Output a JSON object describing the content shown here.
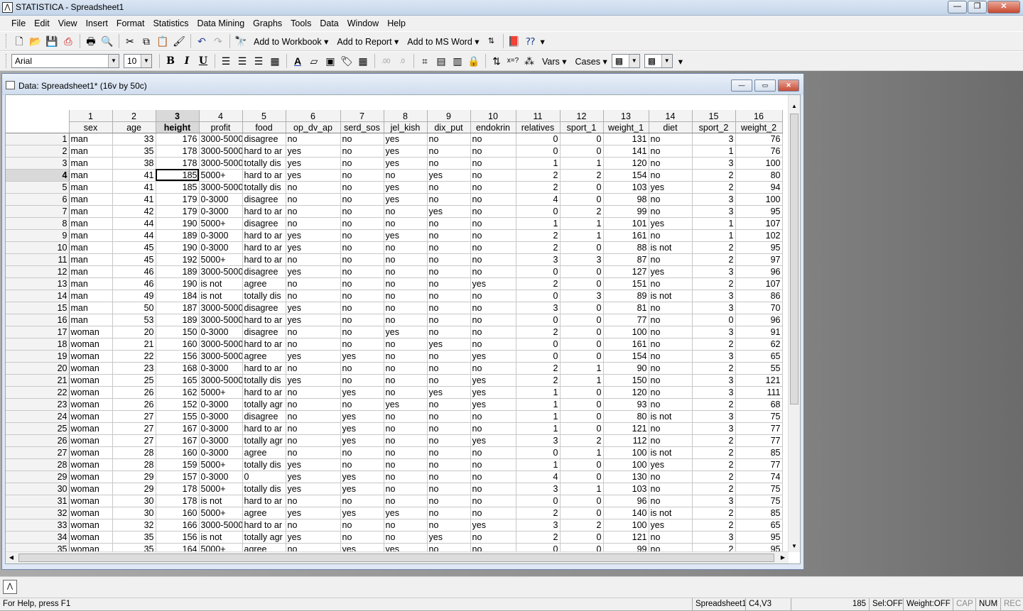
{
  "window": {
    "title": "STATISTICA - Spreadsheet1",
    "app_icon": "statistica-icon"
  },
  "menu": [
    "File",
    "Edit",
    "View",
    "Insert",
    "Format",
    "Statistics",
    "Data Mining",
    "Graphs",
    "Tools",
    "Data",
    "Window",
    "Help"
  ],
  "toolbar1": {
    "add_to_workbook": "Add to Workbook",
    "add_to_report": "Add to Report",
    "add_to_msword": "Add to MS Word"
  },
  "toolbar2": {
    "font": "Arial",
    "size": "10",
    "bold": "B",
    "italic": "I",
    "underline": "U",
    "vars": "Vars",
    "cases": "Cases"
  },
  "document": {
    "title": "Data: Spreadsheet1* (16v by 50c)",
    "selected_column": 3,
    "selected_row": 4,
    "columns": [
      {
        "num": "1",
        "name": "sex",
        "align": "t"
      },
      {
        "num": "2",
        "name": "age",
        "align": "n"
      },
      {
        "num": "3",
        "name": "height",
        "align": "n"
      },
      {
        "num": "4",
        "name": "profit",
        "align": "t"
      },
      {
        "num": "5",
        "name": "food",
        "align": "t"
      },
      {
        "num": "6",
        "name": "op_dv_ap",
        "align": "t"
      },
      {
        "num": "7",
        "name": "serd_sos",
        "align": "t"
      },
      {
        "num": "8",
        "name": "jel_kish",
        "align": "t"
      },
      {
        "num": "9",
        "name": "dix_put",
        "align": "t"
      },
      {
        "num": "10",
        "name": "endokrin",
        "align": "t"
      },
      {
        "num": "11",
        "name": "relatives",
        "align": "n"
      },
      {
        "num": "12",
        "name": "sport_1",
        "align": "n"
      },
      {
        "num": "13",
        "name": "weight_1",
        "align": "n"
      },
      {
        "num": "14",
        "name": "diet",
        "align": "t"
      },
      {
        "num": "15",
        "name": "sport_2",
        "align": "n"
      },
      {
        "num": "16",
        "name": "weight_2",
        "align": "n"
      }
    ],
    "rows": [
      [
        "1",
        "man",
        "33",
        "176",
        "3000-5000",
        "disagree",
        "no",
        "no",
        "yes",
        "no",
        "no",
        "0",
        "0",
        "131",
        "no",
        "3",
        "76"
      ],
      [
        "2",
        "man",
        "35",
        "178",
        "3000-5000",
        "hard to ar",
        "yes",
        "no",
        "yes",
        "no",
        "no",
        "0",
        "0",
        "141",
        "no",
        "1",
        "76"
      ],
      [
        "3",
        "man",
        "38",
        "178",
        "3000-5000",
        "totally dis",
        "yes",
        "no",
        "yes",
        "no",
        "no",
        "1",
        "1",
        "120",
        "no",
        "3",
        "100"
      ],
      [
        "4",
        "man",
        "41",
        "185",
        "5000+",
        "hard to ar",
        "yes",
        "no",
        "no",
        "yes",
        "no",
        "2",
        "2",
        "154",
        "no",
        "2",
        "80"
      ],
      [
        "5",
        "man",
        "41",
        "185",
        "3000-5000",
        "totally dis",
        "no",
        "no",
        "yes",
        "no",
        "no",
        "2",
        "0",
        "103",
        "yes",
        "2",
        "94"
      ],
      [
        "6",
        "man",
        "41",
        "179",
        "0-3000",
        "disagree",
        "no",
        "no",
        "yes",
        "no",
        "no",
        "4",
        "0",
        "98",
        "no",
        "3",
        "100"
      ],
      [
        "7",
        "man",
        "42",
        "179",
        "0-3000",
        "hard to ar",
        "no",
        "no",
        "no",
        "yes",
        "no",
        "0",
        "2",
        "99",
        "no",
        "3",
        "95"
      ],
      [
        "8",
        "man",
        "44",
        "190",
        "5000+",
        "disagree",
        "no",
        "no",
        "no",
        "no",
        "no",
        "1",
        "1",
        "101",
        "yes",
        "1",
        "107"
      ],
      [
        "9",
        "man",
        "44",
        "189",
        "0-3000",
        "hard to ar",
        "yes",
        "no",
        "yes",
        "no",
        "no",
        "2",
        "1",
        "161",
        "no",
        "1",
        "102"
      ],
      [
        "10",
        "man",
        "45",
        "190",
        "0-3000",
        "hard to ar",
        "yes",
        "no",
        "no",
        "no",
        "no",
        "2",
        "0",
        "88",
        "is not",
        "2",
        "95"
      ],
      [
        "11",
        "man",
        "45",
        "192",
        "5000+",
        "hard to ar",
        "no",
        "no",
        "no",
        "no",
        "no",
        "3",
        "3",
        "87",
        "no",
        "2",
        "97"
      ],
      [
        "12",
        "man",
        "46",
        "189",
        "3000-5000",
        "disagree",
        "yes",
        "no",
        "no",
        "no",
        "no",
        "0",
        "0",
        "127",
        "yes",
        "3",
        "96"
      ],
      [
        "13",
        "man",
        "46",
        "190",
        "is not",
        "agree",
        "no",
        "no",
        "no",
        "no",
        "yes",
        "2",
        "0",
        "151",
        "no",
        "2",
        "107"
      ],
      [
        "14",
        "man",
        "49",
        "184",
        "is not",
        "totally dis",
        "no",
        "no",
        "no",
        "no",
        "no",
        "0",
        "3",
        "89",
        "is not",
        "3",
        "86"
      ],
      [
        "15",
        "man",
        "50",
        "187",
        "3000-5000",
        "disagree",
        "yes",
        "no",
        "no",
        "no",
        "no",
        "3",
        "0",
        "81",
        "no",
        "3",
        "70"
      ],
      [
        "16",
        "man",
        "53",
        "189",
        "3000-5000",
        "hard to ar",
        "yes",
        "no",
        "no",
        "no",
        "no",
        "0",
        "0",
        "77",
        "no",
        "0",
        "96"
      ],
      [
        "17",
        "woman",
        "20",
        "150",
        "0-3000",
        "disagree",
        "no",
        "no",
        "yes",
        "no",
        "no",
        "2",
        "0",
        "100",
        "no",
        "3",
        "91"
      ],
      [
        "18",
        "woman",
        "21",
        "160",
        "3000-5000",
        "hard to ar",
        "no",
        "no",
        "no",
        "yes",
        "no",
        "0",
        "0",
        "161",
        "no",
        "2",
        "62"
      ],
      [
        "19",
        "woman",
        "22",
        "156",
        "3000-5000",
        "agree",
        "yes",
        "yes",
        "no",
        "no",
        "yes",
        "0",
        "0",
        "154",
        "no",
        "3",
        "65"
      ],
      [
        "20",
        "woman",
        "23",
        "168",
        "0-3000",
        "hard to ar",
        "no",
        "no",
        "no",
        "no",
        "no",
        "2",
        "1",
        "90",
        "no",
        "2",
        "55"
      ],
      [
        "21",
        "woman",
        "25",
        "165",
        "3000-5000",
        "totally dis",
        "yes",
        "no",
        "no",
        "no",
        "yes",
        "2",
        "1",
        "150",
        "no",
        "3",
        "121"
      ],
      [
        "22",
        "woman",
        "26",
        "162",
        "5000+",
        "hard to ar",
        "no",
        "yes",
        "no",
        "yes",
        "yes",
        "1",
        "0",
        "120",
        "no",
        "3",
        "111"
      ],
      [
        "23",
        "woman",
        "26",
        "152",
        "0-3000",
        "totally agr",
        "no",
        "no",
        "yes",
        "no",
        "yes",
        "1",
        "0",
        "93",
        "no",
        "2",
        "68"
      ],
      [
        "24",
        "woman",
        "27",
        "155",
        "0-3000",
        "disagree",
        "no",
        "yes",
        "no",
        "no",
        "no",
        "1",
        "0",
        "80",
        "is not",
        "3",
        "75"
      ],
      [
        "25",
        "woman",
        "27",
        "167",
        "0-3000",
        "hard to ar",
        "no",
        "yes",
        "no",
        "no",
        "no",
        "1",
        "0",
        "121",
        "no",
        "3",
        "77"
      ],
      [
        "26",
        "woman",
        "27",
        "167",
        "0-3000",
        "totally agr",
        "no",
        "yes",
        "no",
        "no",
        "yes",
        "3",
        "2",
        "112",
        "no",
        "2",
        "77"
      ],
      [
        "27",
        "woman",
        "28",
        "160",
        "0-3000",
        "agree",
        "no",
        "no",
        "no",
        "no",
        "no",
        "0",
        "1",
        "100",
        "is not",
        "2",
        "85"
      ],
      [
        "28",
        "woman",
        "28",
        "159",
        "5000+",
        "totally dis",
        "yes",
        "no",
        "no",
        "no",
        "no",
        "1",
        "0",
        "100",
        "yes",
        "2",
        "77"
      ],
      [
        "29",
        "woman",
        "29",
        "157",
        "0-3000",
        "0",
        "yes",
        "yes",
        "no",
        "no",
        "no",
        "4",
        "0",
        "130",
        "no",
        "2",
        "74"
      ],
      [
        "30",
        "woman",
        "29",
        "178",
        "5000+",
        "totally dis",
        "yes",
        "yes",
        "no",
        "no",
        "no",
        "3",
        "1",
        "103",
        "no",
        "2",
        "75"
      ],
      [
        "31",
        "woman",
        "30",
        "178",
        "is not",
        "hard to ar",
        "no",
        "no",
        "no",
        "no",
        "no",
        "0",
        "0",
        "96",
        "no",
        "3",
        "75"
      ],
      [
        "32",
        "woman",
        "30",
        "160",
        "5000+",
        "agree",
        "yes",
        "yes",
        "yes",
        "no",
        "no",
        "2",
        "0",
        "140",
        "is not",
        "2",
        "85"
      ],
      [
        "33",
        "woman",
        "32",
        "166",
        "3000-5000",
        "hard to ar",
        "no",
        "no",
        "no",
        "no",
        "yes",
        "3",
        "2",
        "100",
        "yes",
        "2",
        "65"
      ],
      [
        "34",
        "woman",
        "35",
        "156",
        "is not",
        "totally agr",
        "yes",
        "no",
        "no",
        "yes",
        "no",
        "2",
        "0",
        "121",
        "no",
        "3",
        "95"
      ],
      [
        "35",
        "woman",
        "35",
        "164",
        "5000+",
        "agree",
        "no",
        "yes",
        "yes",
        "no",
        "no",
        "0",
        "0",
        "99",
        "no",
        "2",
        "95"
      ]
    ]
  },
  "status": {
    "help": "For Help, press F1",
    "doc": "Spreadsheet1",
    "cell": "C4,V3",
    "value": "185",
    "sel": "Sel:OFF",
    "weight": "Weight:OFF",
    "cap": "CAP",
    "num": "NUM",
    "rec": "REC"
  }
}
